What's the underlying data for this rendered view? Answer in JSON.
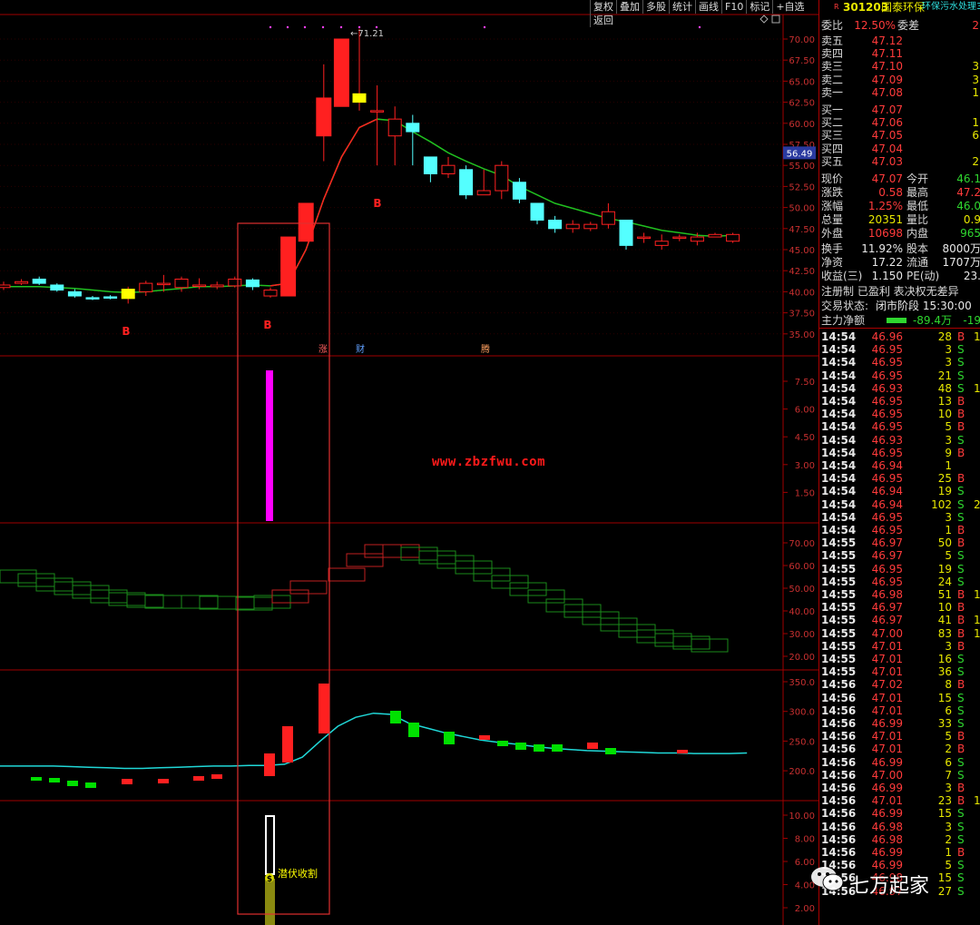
{
  "toolbar": [
    "复权",
    "叠加",
    "多股",
    "统计",
    "画线",
    "F10",
    "标记",
    "+自选",
    "返回"
  ],
  "header": {
    "code": "301203",
    "name": "国泰环保",
    "sector": "环保污水处理3",
    "flag": "R"
  },
  "weibi": {
    "label": "委比",
    "value": "12.50%",
    "label2": "委差",
    "value2": "2"
  },
  "order_book": {
    "asks": [
      {
        "label": "卖五",
        "price": "47.12",
        "vol": ""
      },
      {
        "label": "卖四",
        "price": "47.11",
        "vol": ""
      },
      {
        "label": "卖三",
        "price": "47.10",
        "vol": "3"
      },
      {
        "label": "卖二",
        "price": "47.09",
        "vol": "3"
      },
      {
        "label": "卖一",
        "price": "47.08",
        "vol": "1"
      }
    ],
    "bids": [
      {
        "label": "买一",
        "price": "47.07",
        "vol": ""
      },
      {
        "label": "买二",
        "price": "47.06",
        "vol": "1"
      },
      {
        "label": "买三",
        "price": "47.05",
        "vol": "6"
      },
      {
        "label": "买四",
        "price": "47.04",
        "vol": ""
      },
      {
        "label": "买五",
        "price": "47.03",
        "vol": "2"
      }
    ]
  },
  "quote": [
    {
      "l1": "现价",
      "v1": "47.07",
      "c1": "red",
      "l2": "今开",
      "v2": "46.1",
      "c2": "green"
    },
    {
      "l1": "涨跌",
      "v1": "0.58",
      "c1": "red",
      "l2": "最高",
      "v2": "47.2",
      "c2": "red"
    },
    {
      "l1": "涨幅",
      "v1": "1.25%",
      "c1": "red",
      "l2": "最低",
      "v2": "46.0",
      "c2": "green"
    },
    {
      "l1": "总量",
      "v1": "20351",
      "c1": "yellow",
      "l2": "量比",
      "v2": "0.9",
      "c2": "yellow"
    },
    {
      "l1": "外盘",
      "v1": "10698",
      "c1": "red",
      "l2": "内盘",
      "v2": "965",
      "c2": "green"
    }
  ],
  "fundamentals": [
    {
      "l1": "换手",
      "v1": "11.92%",
      "l2": "股本",
      "v2": "8000万"
    },
    {
      "l1": "净资",
      "v1": "17.22",
      "l2": "流通",
      "v2": "1707万"
    },
    {
      "l1": "收益(三)",
      "v1": "1.150",
      "l2": "PE(动)",
      "v2": "23."
    }
  ],
  "notice": "注册制 已盈利 表决权无差异",
  "trade_status": {
    "label": "交易状态:",
    "value": "闭市阶段 15:30:00"
  },
  "main_flow": {
    "label": "主力净额",
    "value": "-89.4万",
    "value2": "-19"
  },
  "trades": [
    [
      "14:54",
      "46.96",
      "28",
      "B",
      "1"
    ],
    [
      "14:54",
      "46.95",
      "3",
      "S",
      ""
    ],
    [
      "14:54",
      "46.95",
      "3",
      "S",
      ""
    ],
    [
      "14:54",
      "46.95",
      "21",
      "S",
      ""
    ],
    [
      "14:54",
      "46.93",
      "48",
      "S",
      "1"
    ],
    [
      "14:54",
      "46.95",
      "13",
      "B",
      ""
    ],
    [
      "14:54",
      "46.95",
      "10",
      "B",
      ""
    ],
    [
      "14:54",
      "46.95",
      "5",
      "B",
      ""
    ],
    [
      "14:54",
      "46.93",
      "3",
      "S",
      ""
    ],
    [
      "14:54",
      "46.95",
      "9",
      "B",
      ""
    ],
    [
      "14:54",
      "46.94",
      "1",
      "",
      ""
    ],
    [
      "14:54",
      "46.95",
      "25",
      "B",
      ""
    ],
    [
      "14:54",
      "46.94",
      "19",
      "S",
      ""
    ],
    [
      "14:54",
      "46.94",
      "102",
      "S",
      "2"
    ],
    [
      "14:54",
      "46.95",
      "3",
      "S",
      ""
    ],
    [
      "14:54",
      "46.95",
      "1",
      "B",
      ""
    ],
    [
      "14:55",
      "46.97",
      "50",
      "B",
      ""
    ],
    [
      "14:55",
      "46.97",
      "5",
      "S",
      ""
    ],
    [
      "14:55",
      "46.95",
      "19",
      "S",
      ""
    ],
    [
      "14:55",
      "46.95",
      "24",
      "S",
      ""
    ],
    [
      "14:55",
      "46.98",
      "51",
      "B",
      "1"
    ],
    [
      "14:55",
      "46.97",
      "10",
      "B",
      ""
    ],
    [
      "14:55",
      "46.97",
      "41",
      "B",
      "1"
    ],
    [
      "14:55",
      "47.00",
      "83",
      "B",
      "1"
    ],
    [
      "14:55",
      "47.01",
      "3",
      "B",
      ""
    ],
    [
      "14:55",
      "47.01",
      "16",
      "S",
      ""
    ],
    [
      "14:55",
      "47.01",
      "36",
      "S",
      ""
    ],
    [
      "14:56",
      "47.02",
      "8",
      "B",
      ""
    ],
    [
      "14:56",
      "47.01",
      "15",
      "S",
      ""
    ],
    [
      "14:56",
      "47.01",
      "6",
      "S",
      ""
    ],
    [
      "14:56",
      "46.99",
      "33",
      "S",
      ""
    ],
    [
      "14:56",
      "47.01",
      "5",
      "B",
      ""
    ],
    [
      "14:56",
      "47.01",
      "2",
      "B",
      ""
    ],
    [
      "14:56",
      "46.99",
      "6",
      "S",
      ""
    ],
    [
      "14:56",
      "47.00",
      "7",
      "S",
      ""
    ],
    [
      "14:56",
      "46.99",
      "3",
      "B",
      ""
    ],
    [
      "14:56",
      "47.01",
      "23",
      "B",
      "1"
    ],
    [
      "14:56",
      "46.99",
      "15",
      "S",
      ""
    ],
    [
      "14:56",
      "46.98",
      "3",
      "S",
      ""
    ],
    [
      "14:56",
      "46.98",
      "2",
      "S",
      ""
    ],
    [
      "14:56",
      "46.99",
      "1",
      "B",
      ""
    ],
    [
      "14:56",
      "46.99",
      "5",
      "S",
      ""
    ],
    [
      "14:56",
      "46.98",
      "15",
      "S",
      ""
    ],
    [
      "14:56",
      "46.97",
      "27",
      "S",
      ""
    ]
  ],
  "watermark": "www.zbzfwu.com",
  "brand": "七万起家",
  "chart_data": [
    {
      "type": "candlestick",
      "panel": "price",
      "y_ticks": [
        "70.00",
        "67.50",
        "65.00",
        "62.50",
        "60.00",
        "57.50",
        "55.00",
        "52.50",
        "50.00",
        "47.50",
        "45.00",
        "42.50",
        "40.00",
        "37.50",
        "35.00"
      ],
      "ylim": [
        35,
        71.5
      ],
      "current_price_tag": "56.49",
      "current_price_value": 56.49,
      "high_annotation": "71.21",
      "candles": [
        [
          40.5,
          40.8,
          41.2,
          40.2
        ],
        [
          41.0,
          41.2,
          41.5,
          40.8
        ],
        [
          41.5,
          41.0,
          41.8,
          40.8
        ],
        [
          40.8,
          40.2,
          41.0,
          40.0
        ],
        [
          40.0,
          39.5,
          40.3,
          39.3
        ],
        [
          39.3,
          39.2,
          39.5,
          39.0
        ],
        [
          39.4,
          39.3,
          39.6,
          39.1
        ],
        [
          39.2,
          40.3,
          40.6,
          38.6
        ],
        [
          40.0,
          41.0,
          41.3,
          39.5
        ],
        [
          41.0,
          41.0,
          42.0,
          40.0
        ],
        [
          40.5,
          41.5,
          41.8,
          40.0
        ],
        [
          40.8,
          40.8,
          41.6,
          40.3
        ],
        [
          40.6,
          40.8,
          41.2,
          40.3
        ],
        [
          40.7,
          41.5,
          41.8,
          40.5
        ],
        [
          41.4,
          40.6,
          41.6,
          40.2
        ],
        [
          39.5,
          40.2,
          40.5,
          39.3
        ],
        [
          39.5,
          46.5,
          46.5,
          39.5
        ],
        [
          46.0,
          50.5,
          50.5,
          46.0
        ],
        [
          58.5,
          63.0,
          67.0,
          55.5
        ],
        [
          62.0,
          70.0,
          70.0,
          62.0
        ],
        [
          62.5,
          63.5,
          71.2,
          61.5
        ],
        [
          61.5,
          61.5,
          64.5,
          55.0
        ],
        [
          58.5,
          60.5,
          62.0,
          55.0
        ],
        [
          60.0,
          59.0,
          61.0,
          55.0
        ],
        [
          56.0,
          54.0,
          56.0,
          53.0
        ],
        [
          54.0,
          55.0,
          56.0,
          53.5
        ],
        [
          54.5,
          51.5,
          55.0,
          51.0
        ],
        [
          51.5,
          52.0,
          54.5,
          51.5
        ],
        [
          52.0,
          55.0,
          55.5,
          51.0
        ],
        [
          53.0,
          51.0,
          53.5,
          50.5
        ],
        [
          50.5,
          48.5,
          50.5,
          48.0
        ],
        [
          48.5,
          47.5,
          49.0,
          47.0
        ],
        [
          47.5,
          48.0,
          48.5,
          47.0
        ],
        [
          47.5,
          48.0,
          48.3,
          47.2
        ],
        [
          48.0,
          49.5,
          50.5,
          47.5
        ],
        [
          48.5,
          45.5,
          48.5,
          45.0
        ],
        [
          46.5,
          46.5,
          47.0,
          45.8
        ],
        [
          45.5,
          46.0,
          46.8,
          45.0
        ],
        [
          46.5,
          46.5,
          46.8,
          46.0
        ],
        [
          46.0,
          46.5,
          47.0,
          45.5
        ],
        [
          46.5,
          46.8,
          47.0,
          46.5
        ],
        [
          46.0,
          46.8,
          47.0,
          45.8
        ]
      ],
      "ma": [
        40.6,
        40.6,
        40.6,
        40.5,
        40.4,
        40.2,
        40.0,
        39.9,
        40.0,
        40.2,
        40.4,
        40.6,
        40.6,
        40.7,
        40.8,
        40.7,
        41.0,
        45.0,
        51.0,
        56.0,
        59.5,
        60.5,
        60.3,
        59.0,
        57.8,
        56.5,
        55.5,
        54.6,
        53.8,
        52.5,
        51.5,
        50.5,
        49.9,
        49.3,
        48.7,
        48.3,
        47.8,
        47.3,
        47.0,
        46.7,
        46.6,
        46.7
      ],
      "mark_B": [
        "B",
        "B",
        "B"
      ],
      "event_labels": [
        "涨",
        "财",
        "腾"
      ]
    },
    {
      "type": "bar",
      "panel": "indicator-1",
      "y_ticks": [
        "7.50",
        "6.00",
        "4.50",
        "3.00",
        "1.50"
      ],
      "values_note_index": 16,
      "value": 8.0
    },
    {
      "type": "bar",
      "panel": "indicator-3-volume",
      "y_ticks": [
        "350.0",
        "300.0",
        "250.0",
        "200.0"
      ],
      "line": [
        208,
        208,
        208,
        208,
        207,
        206,
        205,
        204,
        204,
        205,
        206,
        207,
        208,
        208,
        209,
        209,
        211,
        223,
        250,
        275,
        290,
        297,
        295,
        280,
        272,
        264,
        258,
        252,
        248,
        245,
        241,
        238,
        236,
        234,
        233,
        232,
        231,
        230,
        230,
        229,
        229,
        229,
        230
      ]
    },
    {
      "type": "bar",
      "panel": "indicator-4",
      "y_ticks": [
        "10.00",
        "8.00",
        "6.00",
        "4.00",
        "2.00"
      ],
      "annotation": "潜伏收割",
      "annotation_marker": "$"
    },
    {
      "type": "line",
      "panel": "indicator-2-boxes",
      "y_ticks": [
        "70.00",
        "60.00",
        "50.00",
        "40.00",
        "30.00",
        "20.00"
      ]
    }
  ]
}
